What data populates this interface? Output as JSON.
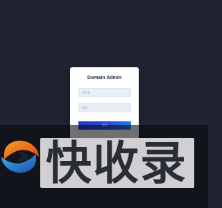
{
  "login": {
    "title": "Domain Admin",
    "username_placeholder": "用户名",
    "password_placeholder": "密码",
    "submit_label": "登录"
  },
  "watermark": {
    "text": "快收录"
  },
  "colors": {
    "page_background": "#1f2430",
    "card_background": "#ffffff",
    "input_background": "#e9eef6",
    "button_gradient_start": "#2535c9",
    "button_gradient_end": "#1a80e6",
    "watermark_box": "#d0d0d2",
    "watermark_text": "#2a2d36"
  }
}
